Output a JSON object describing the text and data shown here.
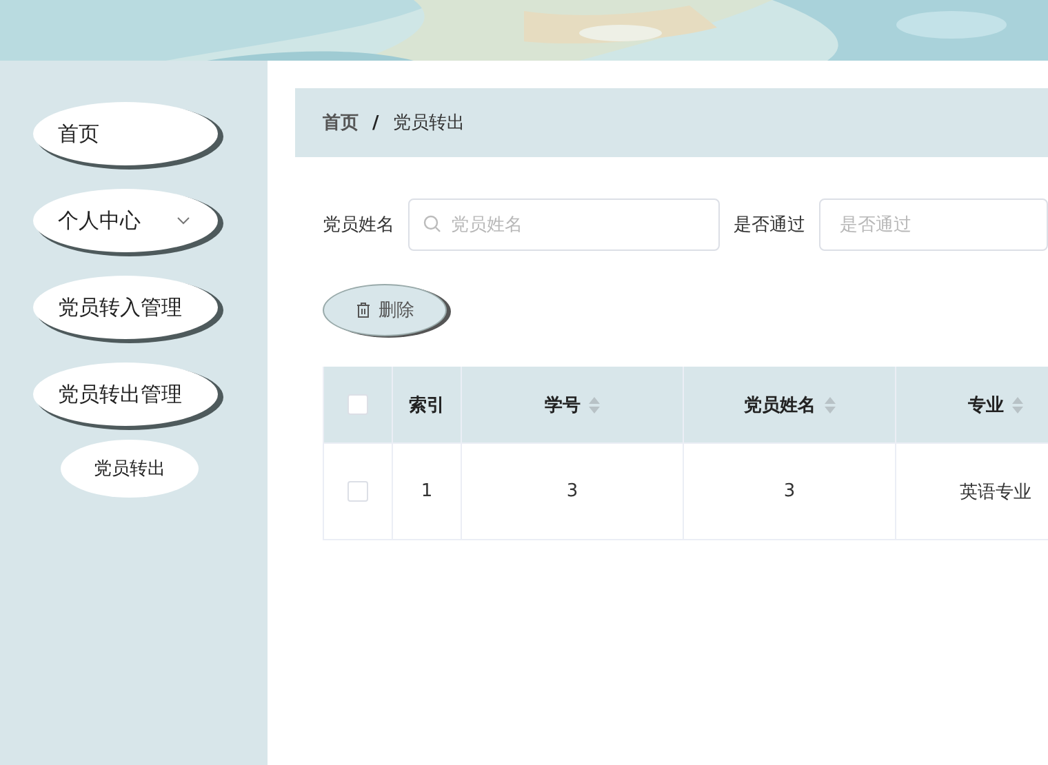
{
  "sidebar": {
    "items": [
      {
        "label": "首页",
        "has_children": false
      },
      {
        "label": "个人中心",
        "has_children": true
      },
      {
        "label": "党员转入管理",
        "has_children": false
      },
      {
        "label": "党员转出管理",
        "has_children": false,
        "children": [
          {
            "label": "党员转出"
          }
        ]
      }
    ]
  },
  "breadcrumb": {
    "separator": "/",
    "items": [
      "首页",
      "党员转出"
    ]
  },
  "filters": [
    {
      "label": "党员姓名",
      "placeholder": "党员姓名",
      "search_icon": true
    },
    {
      "label": "是否通过",
      "placeholder": "是否通过",
      "search_icon": false
    }
  ],
  "actions": [
    {
      "label": "删除"
    }
  ],
  "table": {
    "select_all_checked": false,
    "columns": [
      {
        "label": "索引",
        "sortable": false
      },
      {
        "label": "学号",
        "sortable": true
      },
      {
        "label": "党员姓名",
        "sortable": true
      },
      {
        "label": "专业",
        "sortable": true
      }
    ],
    "rows": [
      {
        "checked": false,
        "cells": [
          "1",
          "3",
          "3",
          "英语专业"
        ]
      }
    ]
  }
}
